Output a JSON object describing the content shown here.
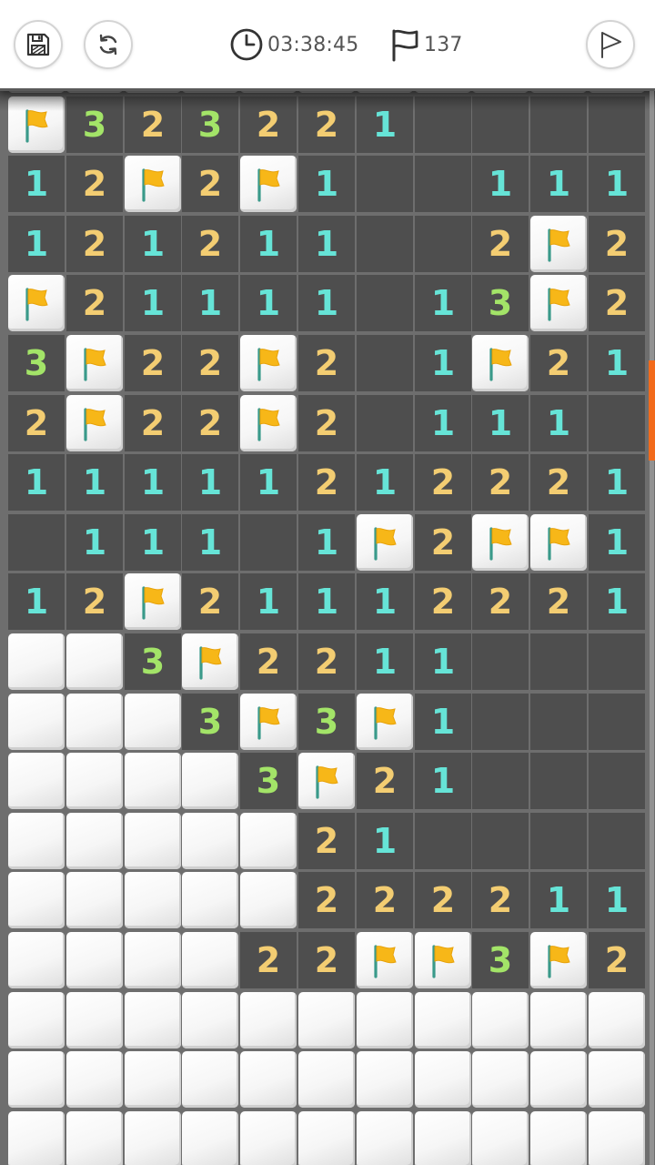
{
  "toolbar": {
    "save_icon": "floppy-disk-icon",
    "restart_icon": "refresh-icon",
    "flag_mode_icon": "flag-outline-icon"
  },
  "status": {
    "timer_icon": "clock-icon",
    "time": "03:38:45",
    "flags_icon": "flag-outline-icon",
    "flags_remaining": "137"
  },
  "colors": {
    "number_1": "#66e4d7",
    "number_2": "#f3cd72",
    "number_3": "#a3e468",
    "flag": "#f7b718",
    "scroll_indicator": "#f26a1b"
  },
  "board": {
    "columns": 11,
    "legend": "C = covered tile, F = flagged tile, 0 = revealed empty, digit = revealed count",
    "rows": [
      [
        "C",
        "C",
        "C",
        "C",
        "C",
        "C",
        "C",
        "C",
        "C",
        "C",
        "C"
      ],
      [
        "F",
        "3",
        "2",
        "3",
        "2",
        "2",
        "1",
        "0",
        "0",
        "0",
        "0"
      ],
      [
        "1",
        "2",
        "F",
        "2",
        "F",
        "1",
        "0",
        "0",
        "1",
        "1",
        "1"
      ],
      [
        "1",
        "2",
        "1",
        "2",
        "1",
        "1",
        "0",
        "0",
        "2",
        "F",
        "2"
      ],
      [
        "F",
        "2",
        "1",
        "1",
        "1",
        "1",
        "0",
        "1",
        "3",
        "F",
        "2"
      ],
      [
        "3",
        "F",
        "2",
        "2",
        "F",
        "2",
        "0",
        "1",
        "F",
        "2",
        "1"
      ],
      [
        "2",
        "F",
        "2",
        "2",
        "F",
        "2",
        "0",
        "1",
        "1",
        "1",
        "0"
      ],
      [
        "1",
        "1",
        "1",
        "1",
        "1",
        "2",
        "1",
        "2",
        "2",
        "2",
        "1"
      ],
      [
        "0",
        "1",
        "1",
        "1",
        "0",
        "1",
        "F",
        "2",
        "F",
        "F",
        "1"
      ],
      [
        "1",
        "2",
        "F",
        "2",
        "1",
        "1",
        "1",
        "2",
        "2",
        "2",
        "1"
      ],
      [
        "C",
        "C",
        "3",
        "F",
        "2",
        "2",
        "1",
        "1",
        "0",
        "0",
        "0"
      ],
      [
        "C",
        "C",
        "C",
        "3",
        "F",
        "3",
        "F",
        "1",
        "0",
        "0",
        "0"
      ],
      [
        "C",
        "C",
        "C",
        "C",
        "3",
        "F",
        "2",
        "1",
        "0",
        "0",
        "0"
      ],
      [
        "C",
        "C",
        "C",
        "C",
        "C",
        "2",
        "1",
        "0",
        "0",
        "0",
        "0"
      ],
      [
        "C",
        "C",
        "C",
        "C",
        "C",
        "2",
        "2",
        "2",
        "2",
        "1",
        "1"
      ],
      [
        "C",
        "C",
        "C",
        "C",
        "2",
        "2",
        "F",
        "F",
        "3",
        "F",
        "2"
      ],
      [
        "C",
        "C",
        "C",
        "C",
        "C",
        "C",
        "C",
        "C",
        "C",
        "C",
        "C"
      ],
      [
        "C",
        "C",
        "C",
        "C",
        "C",
        "C",
        "C",
        "C",
        "C",
        "C",
        "C"
      ],
      [
        "C",
        "C",
        "C",
        "C",
        "C",
        "C",
        "C",
        "C",
        "C",
        "C",
        "C"
      ]
    ]
  }
}
